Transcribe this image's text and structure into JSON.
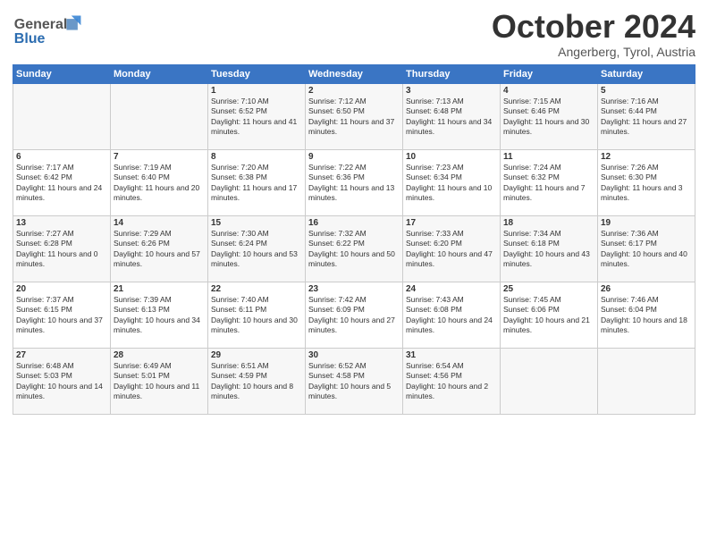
{
  "header": {
    "logo_line1": "General",
    "logo_line2": "Blue",
    "month": "October 2024",
    "location": "Angerberg, Tyrol, Austria"
  },
  "days_of_week": [
    "Sunday",
    "Monday",
    "Tuesday",
    "Wednesday",
    "Thursday",
    "Friday",
    "Saturday"
  ],
  "weeks": [
    [
      {
        "day": "",
        "content": ""
      },
      {
        "day": "",
        "content": ""
      },
      {
        "day": "1",
        "content": "Sunrise: 7:10 AM\nSunset: 6:52 PM\nDaylight: 11 hours and 41 minutes."
      },
      {
        "day": "2",
        "content": "Sunrise: 7:12 AM\nSunset: 6:50 PM\nDaylight: 11 hours and 37 minutes."
      },
      {
        "day": "3",
        "content": "Sunrise: 7:13 AM\nSunset: 6:48 PM\nDaylight: 11 hours and 34 minutes."
      },
      {
        "day": "4",
        "content": "Sunrise: 7:15 AM\nSunset: 6:46 PM\nDaylight: 11 hours and 30 minutes."
      },
      {
        "day": "5",
        "content": "Sunrise: 7:16 AM\nSunset: 6:44 PM\nDaylight: 11 hours and 27 minutes."
      }
    ],
    [
      {
        "day": "6",
        "content": "Sunrise: 7:17 AM\nSunset: 6:42 PM\nDaylight: 11 hours and 24 minutes."
      },
      {
        "day": "7",
        "content": "Sunrise: 7:19 AM\nSunset: 6:40 PM\nDaylight: 11 hours and 20 minutes."
      },
      {
        "day": "8",
        "content": "Sunrise: 7:20 AM\nSunset: 6:38 PM\nDaylight: 11 hours and 17 minutes."
      },
      {
        "day": "9",
        "content": "Sunrise: 7:22 AM\nSunset: 6:36 PM\nDaylight: 11 hours and 13 minutes."
      },
      {
        "day": "10",
        "content": "Sunrise: 7:23 AM\nSunset: 6:34 PM\nDaylight: 11 hours and 10 minutes."
      },
      {
        "day": "11",
        "content": "Sunrise: 7:24 AM\nSunset: 6:32 PM\nDaylight: 11 hours and 7 minutes."
      },
      {
        "day": "12",
        "content": "Sunrise: 7:26 AM\nSunset: 6:30 PM\nDaylight: 11 hours and 3 minutes."
      }
    ],
    [
      {
        "day": "13",
        "content": "Sunrise: 7:27 AM\nSunset: 6:28 PM\nDaylight: 11 hours and 0 minutes."
      },
      {
        "day": "14",
        "content": "Sunrise: 7:29 AM\nSunset: 6:26 PM\nDaylight: 10 hours and 57 minutes."
      },
      {
        "day": "15",
        "content": "Sunrise: 7:30 AM\nSunset: 6:24 PM\nDaylight: 10 hours and 53 minutes."
      },
      {
        "day": "16",
        "content": "Sunrise: 7:32 AM\nSunset: 6:22 PM\nDaylight: 10 hours and 50 minutes."
      },
      {
        "day": "17",
        "content": "Sunrise: 7:33 AM\nSunset: 6:20 PM\nDaylight: 10 hours and 47 minutes."
      },
      {
        "day": "18",
        "content": "Sunrise: 7:34 AM\nSunset: 6:18 PM\nDaylight: 10 hours and 43 minutes."
      },
      {
        "day": "19",
        "content": "Sunrise: 7:36 AM\nSunset: 6:17 PM\nDaylight: 10 hours and 40 minutes."
      }
    ],
    [
      {
        "day": "20",
        "content": "Sunrise: 7:37 AM\nSunset: 6:15 PM\nDaylight: 10 hours and 37 minutes."
      },
      {
        "day": "21",
        "content": "Sunrise: 7:39 AM\nSunset: 6:13 PM\nDaylight: 10 hours and 34 minutes."
      },
      {
        "day": "22",
        "content": "Sunrise: 7:40 AM\nSunset: 6:11 PM\nDaylight: 10 hours and 30 minutes."
      },
      {
        "day": "23",
        "content": "Sunrise: 7:42 AM\nSunset: 6:09 PM\nDaylight: 10 hours and 27 minutes."
      },
      {
        "day": "24",
        "content": "Sunrise: 7:43 AM\nSunset: 6:08 PM\nDaylight: 10 hours and 24 minutes."
      },
      {
        "day": "25",
        "content": "Sunrise: 7:45 AM\nSunset: 6:06 PM\nDaylight: 10 hours and 21 minutes."
      },
      {
        "day": "26",
        "content": "Sunrise: 7:46 AM\nSunset: 6:04 PM\nDaylight: 10 hours and 18 minutes."
      }
    ],
    [
      {
        "day": "27",
        "content": "Sunrise: 6:48 AM\nSunset: 5:03 PM\nDaylight: 10 hours and 14 minutes."
      },
      {
        "day": "28",
        "content": "Sunrise: 6:49 AM\nSunset: 5:01 PM\nDaylight: 10 hours and 11 minutes."
      },
      {
        "day": "29",
        "content": "Sunrise: 6:51 AM\nSunset: 4:59 PM\nDaylight: 10 hours and 8 minutes."
      },
      {
        "day": "30",
        "content": "Sunrise: 6:52 AM\nSunset: 4:58 PM\nDaylight: 10 hours and 5 minutes."
      },
      {
        "day": "31",
        "content": "Sunrise: 6:54 AM\nSunset: 4:56 PM\nDaylight: 10 hours and 2 minutes."
      },
      {
        "day": "",
        "content": ""
      },
      {
        "day": "",
        "content": ""
      }
    ]
  ]
}
